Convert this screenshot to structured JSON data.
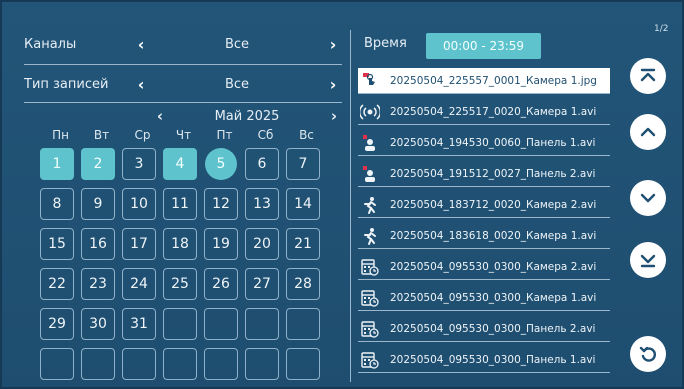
{
  "filters": {
    "channels_label": "Каналы",
    "channels_value": "Все",
    "type_label": "Тип записей",
    "type_value": "Все"
  },
  "calendar": {
    "month": "Май 2025",
    "weekdays": [
      "Пн",
      "Вт",
      "Ср",
      "Чт",
      "Пт",
      "Сб",
      "Вс"
    ],
    "recorded_days": [
      1,
      2,
      4
    ],
    "selected_day": 5
  },
  "right": {
    "time_label": "Время",
    "time_range": "00:00 - 23:59",
    "page_indicator": "1/2"
  },
  "files": [
    {
      "icon": "photo-motion-icon",
      "name": "20250504_225557_0001_Камера 1.jpg",
      "selected": true
    },
    {
      "icon": "sensor-icon",
      "name": "20250504_225517_0020_Камера 1.avi",
      "selected": false
    },
    {
      "icon": "call-panel-icon",
      "name": "20250504_194530_0060_Панель 1.avi",
      "selected": false
    },
    {
      "icon": "call-panel-icon",
      "name": "20250504_191512_0027_Панель 2.avi",
      "selected": false
    },
    {
      "icon": "motion-icon",
      "name": "20250504_183712_0020_Камера 2.avi",
      "selected": false
    },
    {
      "icon": "motion-icon",
      "name": "20250504_183618_0020_Камера 1.avi",
      "selected": false
    },
    {
      "icon": "schedule-icon",
      "name": "20250504_095530_0300_Камера 2.avi",
      "selected": false
    },
    {
      "icon": "schedule-icon",
      "name": "20250504_095530_0300_Камера 1.avi",
      "selected": false
    },
    {
      "icon": "schedule-icon",
      "name": "20250504_095530_0300_Панель 2.avi",
      "selected": false
    },
    {
      "icon": "schedule-icon",
      "name": "20250504_095530_0300_Панель 1.avi",
      "selected": false
    }
  ],
  "colors": {
    "background": "#1f4f72",
    "accent": "#5ec3cc",
    "text": "#eef4f8",
    "record_marker": "#e0324b"
  },
  "buttons": [
    "first-page-icon",
    "page-up-icon",
    "page-down-icon",
    "last-page-icon",
    "back-icon"
  ]
}
